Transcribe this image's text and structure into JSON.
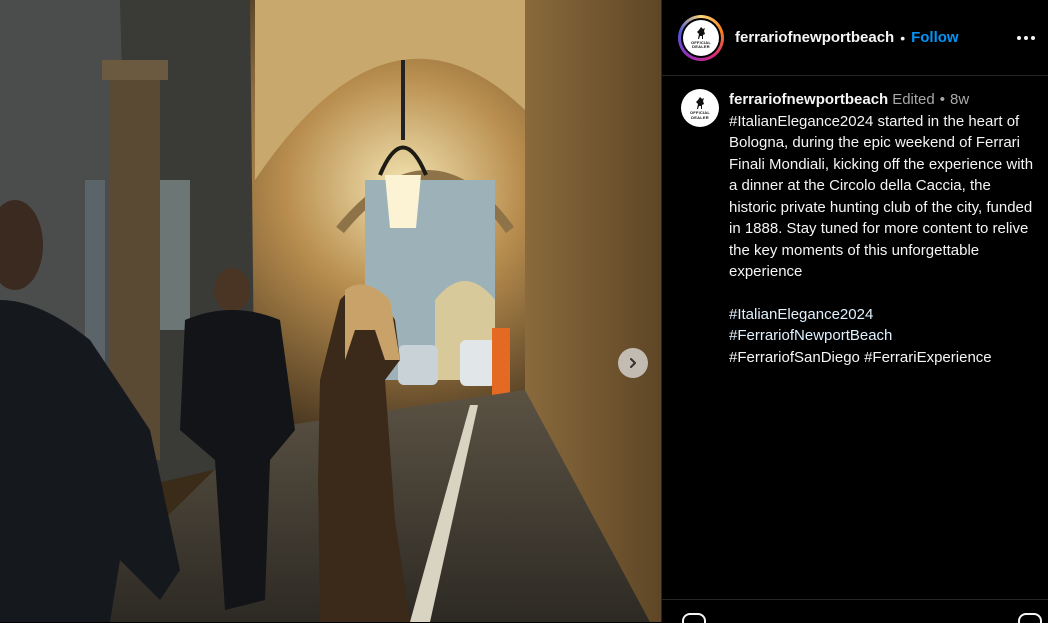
{
  "post": {
    "username": "ferrariofnewportbeach",
    "follow_label": "Follow",
    "avatar_badge_line1": "OFFICIAL",
    "avatar_badge_line2": "DEALER"
  },
  "caption": {
    "username": "ferrariofnewportbeach",
    "edited": "Edited",
    "separator": "•",
    "age": "8w",
    "text": "#ItalianElegance2024 started in the heart of Bologna, during the epic weekend of Ferrari Finali Mondiali, kicking off the experience with a dinner at the Circolo della Caccia, the historic private hunting club of the city, funded in 1888. Stay tuned for more content to relive the key moments of this unforgettable experience",
    "hashtags": [
      "#ItalianElegance2024",
      "#FerrariofNewportBeach",
      "#FerrariofSanDiego",
      "#FerrariExperience"
    ]
  },
  "icons": {
    "more": "more-horizontal-icon",
    "next": "chevron-right-icon",
    "logo": "prancing-horse-icon"
  },
  "colors": {
    "follow": "#0095f6",
    "background": "#000000",
    "muted_text": "#a8a8a8"
  }
}
